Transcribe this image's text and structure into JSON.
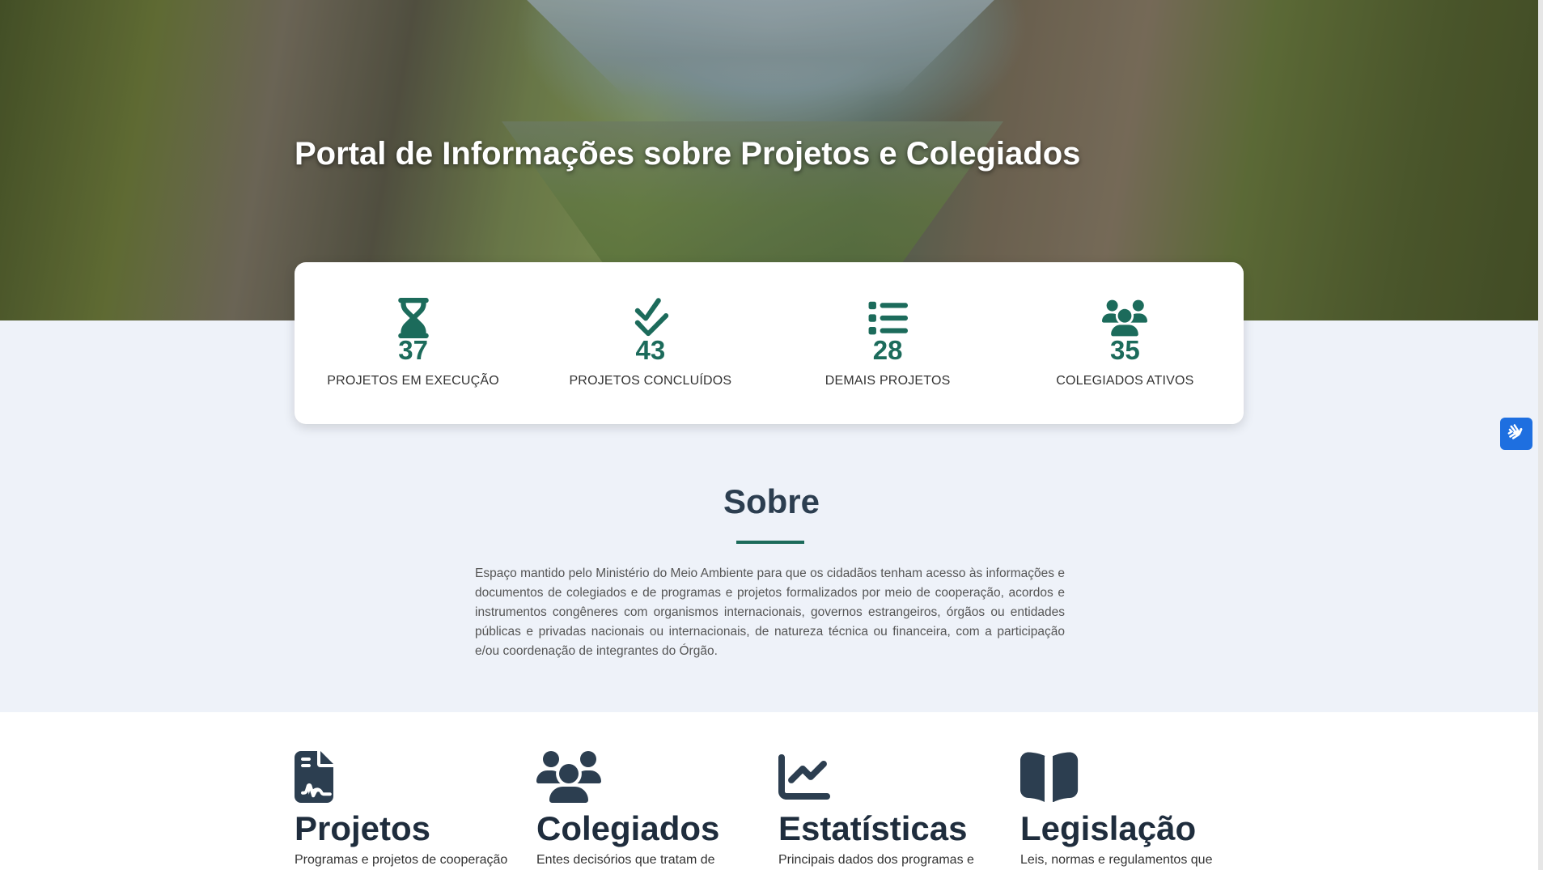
{
  "hero": {
    "title": "Portal de Informações sobre Projetos e Colegiados"
  },
  "stats": [
    {
      "icon": "hourglass-icon",
      "value": "37",
      "label": "PROJETOS EM EXECUÇÃO"
    },
    {
      "icon": "check-double-icon",
      "value": "43",
      "label": "PROJETOS CONCLUÍDOS"
    },
    {
      "icon": "list-icon",
      "value": "28",
      "label": "DEMAIS PROJETOS"
    },
    {
      "icon": "users-icon",
      "value": "35",
      "label": "COLEGIADOS ATIVOS"
    }
  ],
  "about": {
    "title": "Sobre",
    "text": "Espaço mantido pelo Ministério do Meio Ambiente para que os cidadãos tenham acesso às informações e documentos de colegiados e de programas e projetos formalizados por meio de cooperação, acordos e instrumentos congêneres com organismos internacionais, governos estrangeiros, órgãos ou entidades públicas e privadas nacionais ou internacionais, de natureza técnica ou financeira, com a participação e/ou coordenação de integrantes do Órgão."
  },
  "features": [
    {
      "icon": "file-contract-icon",
      "title": "Projetos",
      "desc": "Programas e projetos de cooperação"
    },
    {
      "icon": "users-icon",
      "title": "Colegiados",
      "desc": "Entes decisórios que tratam de"
    },
    {
      "icon": "chart-line-icon",
      "title": "Estatísticas",
      "desc": "Principais dados dos programas e"
    },
    {
      "icon": "book-open-icon",
      "title": "Legislação",
      "desc": "Leis, normas e regulamentos que"
    }
  ],
  "accessibility": {
    "icon": "sign-language-icon"
  },
  "colors": {
    "accent": "#1c6b5b",
    "dark": "#2c3e50",
    "access": "#1e6fe0"
  }
}
